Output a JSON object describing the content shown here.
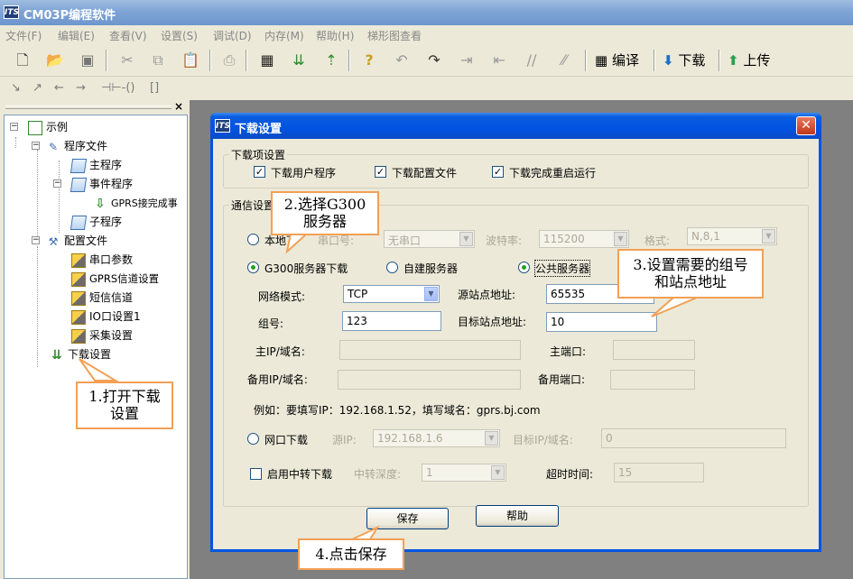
{
  "app": {
    "title": "CM03P编程软件"
  },
  "menubar": {
    "items": [
      "文件(F)",
      "编辑(E)",
      "查看(V)",
      "设置(S)",
      "调试(D)",
      "内存(M)",
      "帮助(H)",
      "梯形图查看"
    ]
  },
  "toolbar": {
    "compile_label": "编译",
    "download_label": "下载",
    "upload_label": "上传",
    "icons": [
      "new-file-icon",
      "open-folder-icon",
      "save-icon",
      "cut-icon",
      "copy-icon",
      "paste-icon",
      "print-icon",
      "monitor-icon",
      "step-icon",
      "upload-arrow-icon",
      "help-icon",
      "undo-icon",
      "redo-icon",
      "indent-icon",
      "outdent-icon",
      "comment-icon",
      "uncomment-icon"
    ]
  },
  "tree": {
    "root": "示例",
    "program_files": "程序文件",
    "main_program": "主程序",
    "event_program": "事件程序",
    "gprs_event": "GPRS接完成事",
    "sub_program": "子程序",
    "config_files": "配置文件",
    "serial_params": "串口参数",
    "gprs_channel": "GPRS信道设置",
    "sms_channel": "短信信道",
    "io_settings": "IO口设置1",
    "acquisition": "采集设置",
    "download_settings": "下载设置"
  },
  "dialog": {
    "title": "下载设置",
    "download_items": {
      "legend": "下载项设置",
      "user_program": "下载用户程序",
      "config_file": "下载配置文件",
      "restart": "下载完成重启运行"
    },
    "comm": {
      "legend": "通信设置",
      "local_label": "本地下",
      "serial_label": "串口号:",
      "serial_value": "无串口",
      "baud_label": "波特率:",
      "baud_value": "115200",
      "format_label": "格式:",
      "format_value": "N,8,1",
      "g300_label": "G300服务器下载",
      "custom_server_label": "自建服务器",
      "public_server_label": "公共服务器",
      "net_mode_label": "网络模式:",
      "net_mode_value": "TCP",
      "src_addr_label": "源站点地址:",
      "src_addr_value": "65535",
      "group_label": "组号:",
      "group_value": "123",
      "dst_addr_label": "目标站点地址:",
      "dst_addr_value": "10",
      "main_ip_label": "主IP/域名:",
      "main_port_label": "主端口:",
      "backup_ip_label": "备用IP/域名:",
      "backup_port_label": "备用端口:",
      "example_text": "例如：要填写IP：192.168.1.52，填写域名：gprs.bj.com",
      "net_dl_label": "网口下载",
      "src_ip_label": "源IP:",
      "src_ip_value": "192.168.1.6",
      "target_ip_label": "目标IP/域名:",
      "target_ip_value": "0",
      "relay_label": "启用中转下载",
      "relay_depth_label": "中转深度:",
      "relay_depth_value": "1",
      "timeout_label": "超时时间:",
      "timeout_value": "15"
    },
    "save_button": "保存",
    "help_button": "帮助"
  },
  "callouts": {
    "step1": "1.打开下载设置",
    "step2": "2.选择G300服务器",
    "step3": "3.设置需要的组号和站点地址",
    "step4": "4.点击保存"
  }
}
